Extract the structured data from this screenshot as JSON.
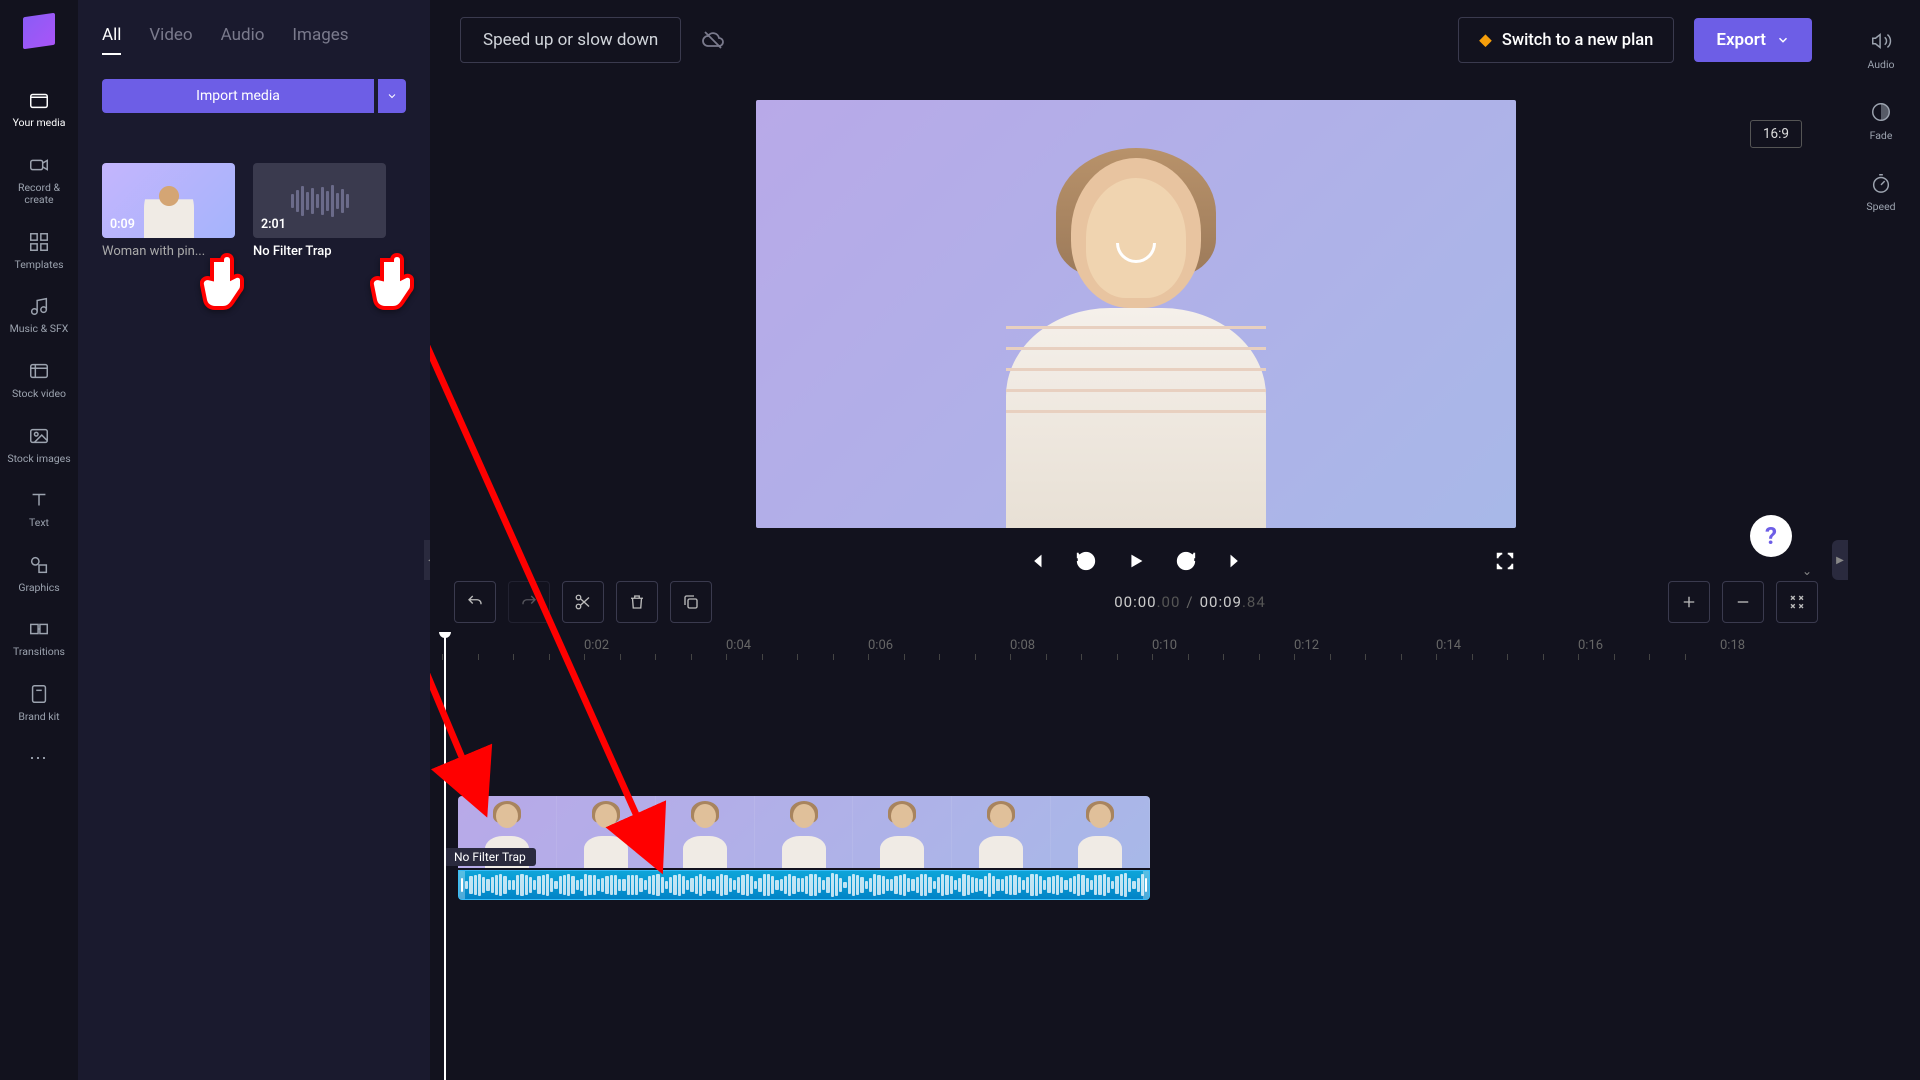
{
  "leftnav": {
    "items": [
      {
        "label": "Your media",
        "icon": "folder"
      },
      {
        "label": "Record & create",
        "icon": "camera"
      },
      {
        "label": "Templates",
        "icon": "grid"
      },
      {
        "label": "Music & SFX",
        "icon": "music"
      },
      {
        "label": "Stock video",
        "icon": "clapper"
      },
      {
        "label": "Stock images",
        "icon": "image"
      },
      {
        "label": "Text",
        "icon": "text"
      },
      {
        "label": "Graphics",
        "icon": "shapes"
      },
      {
        "label": "Transitions",
        "icon": "transition"
      },
      {
        "label": "Brand kit",
        "icon": "brand"
      }
    ]
  },
  "media_panel": {
    "tabs": [
      "All",
      "Video",
      "Audio",
      "Images"
    ],
    "active_tab": 0,
    "import_label": "Import media",
    "clips": [
      {
        "duration": "0:09",
        "title": "Woman with pin...",
        "kind": "video"
      },
      {
        "duration": "2:01",
        "title": "No Filter Trap",
        "kind": "audio"
      }
    ]
  },
  "topbar": {
    "title": "Speed up or slow down",
    "switch_label": "Switch to a new plan",
    "export_label": "Export"
  },
  "preview": {
    "aspect_label": "16:9"
  },
  "timeline": {
    "current_time": "00:00",
    "current_frac": ".00",
    "total_time": "00:09",
    "total_frac": ".84",
    "ruler_marks": [
      "0:02",
      "0:04",
      "0:06",
      "0:08",
      "0:10",
      "0:12",
      "0:14",
      "0:16",
      "0:18"
    ],
    "audio_clip_label": "No Filter Trap"
  },
  "rightnav": {
    "items": [
      {
        "label": "Audio",
        "icon": "speaker"
      },
      {
        "label": "Fade",
        "icon": "fade"
      },
      {
        "label": "Speed",
        "icon": "speed"
      }
    ]
  }
}
